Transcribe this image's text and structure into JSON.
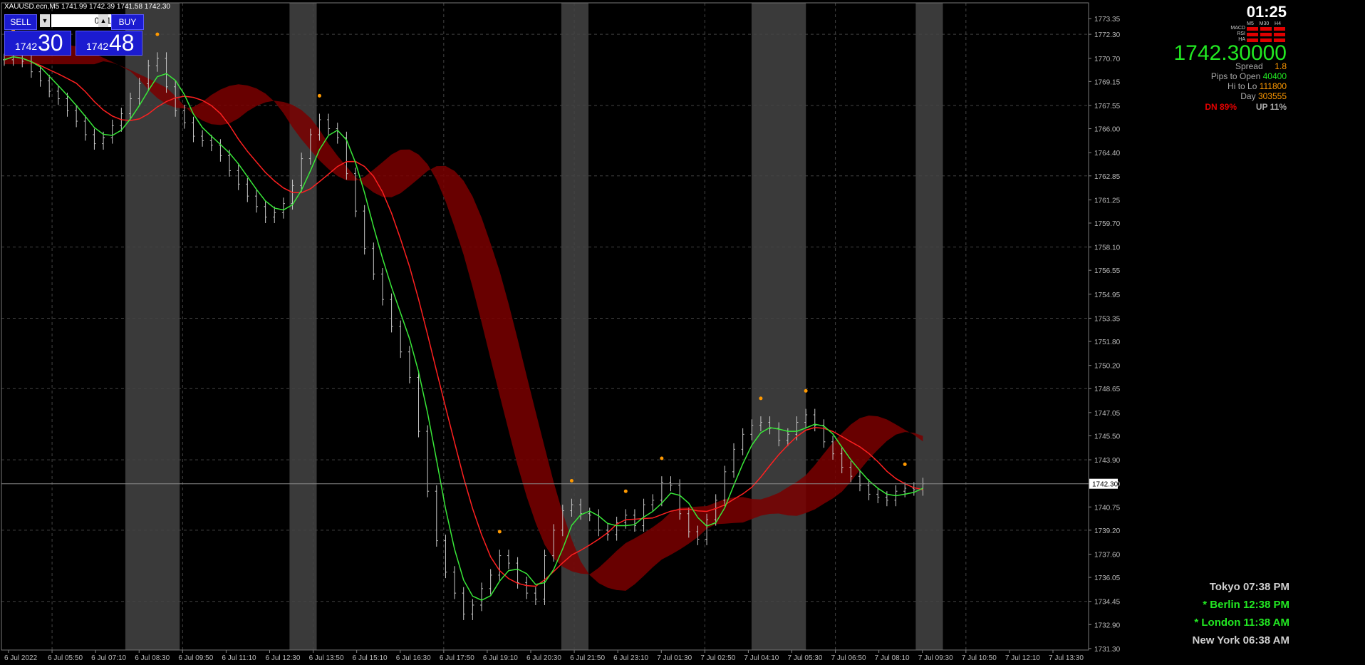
{
  "header": {
    "title": "XAUUSD.ecn,M5  1741.99 1742.39 1741.58 1742.30"
  },
  "trade_panel": {
    "sell_label": "SELL",
    "buy_label": "BUY",
    "lot_value": "0.01",
    "bid_small": "1742",
    "bid_big": "30",
    "ask_small": "1742",
    "ask_big": "48"
  },
  "info_panel": {
    "clock": "01:25",
    "tf": [
      "M5",
      "M30",
      "H4"
    ],
    "indicators": [
      "MACD",
      "RSI",
      "HA"
    ],
    "price": "1742.30000",
    "spread_label": "Spread",
    "spread_value": "1.8",
    "pips_label": "Pips to Open",
    "pips_value": "40400",
    "hilo_label": "Hi to Lo",
    "hilo_value": "111800",
    "day_label": "Day",
    "day_value": "303555",
    "dn": "DN 89%",
    "up": "UP 11%"
  },
  "sessions": [
    {
      "label": "Tokyo 07:38 PM",
      "color": "#cfcfcf"
    },
    {
      "label": "* Berlin 12:38 PM",
      "color": "#22e822"
    },
    {
      "label": "* London 11:38 AM",
      "color": "#22e822"
    },
    {
      "label": "New York 06:38 AM",
      "color": "#cfcfcf"
    }
  ],
  "colors": {
    "background": "#000000",
    "grid": "#444444",
    "candles": "#c8c8c8",
    "red_line": "#ff2020",
    "green_line": "#38e838",
    "cloud_red": "#7a0000",
    "cloud_green": "#006400",
    "dots": "#ff9900",
    "session_band": "#3a3a3a"
  },
  "chart_data": {
    "type": "line",
    "symbol": "XAUUSD.ecn",
    "timeframe": "M5",
    "ylim": [
      1731.2,
      1774.4
    ],
    "y_ticks": [
      "1773.35",
      "1772.30",
      "1770.70",
      "1769.15",
      "1767.55",
      "1766.00",
      "1764.40",
      "1762.85",
      "1761.25",
      "1759.70",
      "1758.10",
      "1756.55",
      "1754.95",
      "1753.35",
      "1751.80",
      "1750.20",
      "1748.65",
      "1747.05",
      "1745.50",
      "1743.90",
      "1742.30",
      "1740.75",
      "1739.20",
      "1737.60",
      "1736.05",
      "1734.45",
      "1732.90",
      "1731.30"
    ],
    "x_ticks": [
      "6 Jul 2022",
      "6 Jul 05:50",
      "6 Jul 07:10",
      "6 Jul 08:30",
      "6 Jul 09:50",
      "6 Jul 11:10",
      "6 Jul 12:30",
      "6 Jul 13:50",
      "6 Jul 15:10",
      "6 Jul 16:30",
      "6 Jul 17:50",
      "6 Jul 19:10",
      "6 Jul 20:30",
      "6 Jul 21:50",
      "6 Jul 23:10",
      "7 Jul 01:30",
      "7 Jul 02:50",
      "7 Jul 04:10",
      "7 Jul 05:30",
      "7 Jul 06:50",
      "7 Jul 08:10",
      "7 Jul 09:30",
      "7 Jul 10:50",
      "7 Jul 12:10",
      "7 Jul 13:30"
    ],
    "current_price": 1742.3,
    "current_price_label": "1742.30",
    "close_approx": [
      1770.6,
      1771.0,
      1770.5,
      1769.8,
      1769.2,
      1768.5,
      1768.0,
      1767.2,
      1766.5,
      1765.6,
      1765.0,
      1765.4,
      1766.2,
      1767.0,
      1768.0,
      1769.0,
      1770.2,
      1770.7,
      1768.8,
      1767.2,
      1766.4,
      1765.5,
      1765.2,
      1764.9,
      1764.2,
      1763.2,
      1762.3,
      1761.5,
      1760.8,
      1760.1,
      1760.4,
      1761.0,
      1762.2,
      1764.0,
      1765.6,
      1766.6,
      1766.0,
      1765.4,
      1763.0,
      1760.5,
      1758.0,
      1756.3,
      1754.6,
      1752.8,
      1751.1,
      1749.4,
      1745.8,
      1741.8,
      1738.5,
      1736.4,
      1735.0,
      1733.6,
      1734.2,
      1735.3,
      1736.2,
      1737.5,
      1737.0,
      1735.7,
      1735.0,
      1734.6,
      1737.5,
      1739.2,
      1740.5,
      1740.9,
      1740.3,
      1740.2,
      1739.2,
      1738.9,
      1739.7,
      1740.2,
      1739.5,
      1740.9,
      1741.2,
      1742.4,
      1742.2,
      1740.3,
      1739.1,
      1738.6,
      1739.9,
      1741.2,
      1743.1,
      1744.6,
      1745.6,
      1746.2,
      1746.4,
      1746.0,
      1745.2,
      1745.6,
      1746.4,
      1746.9,
      1746.2,
      1745.1,
      1744.3,
      1743.4,
      1742.8,
      1742.2,
      1741.6,
      1741.4,
      1741.2,
      1741.8,
      1742.0,
      1741.9,
      1742.3
    ],
    "session_bands_fraction": [
      [
        0.114,
        0.164
      ],
      [
        0.265,
        0.29
      ],
      [
        0.515,
        0.54
      ],
      [
        0.69,
        0.74
      ],
      [
        0.841,
        0.866
      ]
    ]
  }
}
